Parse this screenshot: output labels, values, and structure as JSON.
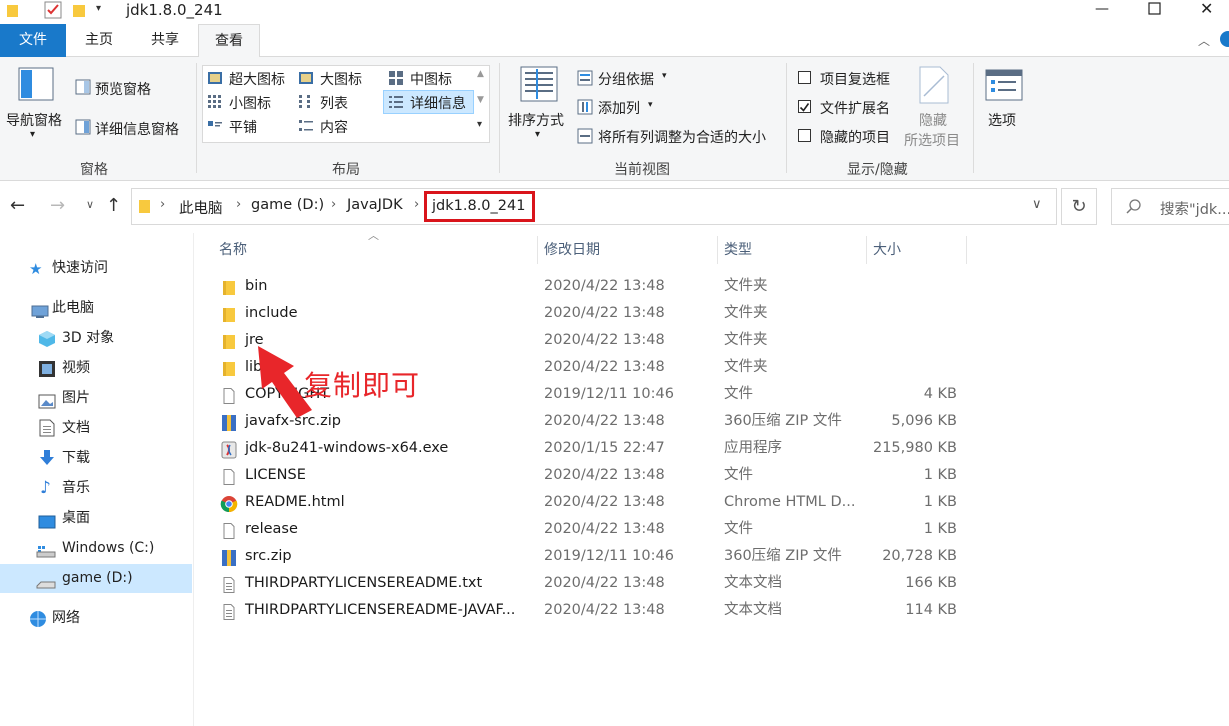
{
  "window": {
    "title": "jdk1.8.0_241"
  },
  "menu_tabs": [
    {
      "label": "文件"
    },
    {
      "label": "主页"
    },
    {
      "label": "共享"
    },
    {
      "label": "查看"
    }
  ],
  "ribbon": {
    "pane": {
      "nav_pane": "导航窗格",
      "preview_pane": "预览窗格",
      "details_pane": "详细信息窗格",
      "group_label": "窗格"
    },
    "layout": {
      "items": [
        "超大图标",
        "大图标",
        "中图标",
        "小图标",
        "列表",
        "详细信息",
        "平铺",
        "内容"
      ],
      "group_label": "布局"
    },
    "current_view": {
      "sort_by": "排序方式",
      "group_by": "分组依据",
      "add_columns": "添加列",
      "size_all_columns": "将所有列调整为合适的大小",
      "group_label": "当前视图"
    },
    "show_hide": {
      "item_checkboxes": "项目复选框",
      "file_extensions": "文件扩展名",
      "hidden_items": "隐藏的项目",
      "hide_selected": "隐藏",
      "hide_selected_2": "所选项目",
      "group_label": "显示/隐藏",
      "item_checkboxes_checked": false,
      "file_extensions_checked": true,
      "hidden_items_checked": false
    },
    "options": {
      "label": "选项"
    }
  },
  "address": {
    "crumbs": [
      "此电脑",
      "game (D:)",
      "JavaJDK",
      "jdk1.8.0_241"
    ],
    "search_placeholder": "搜索\"jdk..."
  },
  "sidebar": {
    "items": [
      {
        "label": "快速访问",
        "icon": "star-icon"
      },
      {
        "label": "此电脑",
        "icon": "computer-icon"
      },
      {
        "label": "3D 对象",
        "icon": "cube-icon"
      },
      {
        "label": "视频",
        "icon": "video-icon"
      },
      {
        "label": "图片",
        "icon": "picture-icon"
      },
      {
        "label": "文档",
        "icon": "document-icon"
      },
      {
        "label": "下载",
        "icon": "download-icon"
      },
      {
        "label": "音乐",
        "icon": "music-icon"
      },
      {
        "label": "桌面",
        "icon": "desktop-icon"
      },
      {
        "label": "Windows (C:)",
        "icon": "windows-drive-icon"
      },
      {
        "label": "game (D:)",
        "icon": "drive-icon",
        "selected": true
      },
      {
        "label": "网络",
        "icon": "network-icon"
      }
    ]
  },
  "columns": {
    "name": "名称",
    "modified": "修改日期",
    "type": "类型",
    "size": "大小"
  },
  "files": [
    {
      "name": "bin",
      "date": "2020/4/22 13:48",
      "type": "文件夹",
      "size": "",
      "icon": "folder-icon"
    },
    {
      "name": "include",
      "date": "2020/4/22 13:48",
      "type": "文件夹",
      "size": "",
      "icon": "folder-icon"
    },
    {
      "name": "jre",
      "date": "2020/4/22 13:48",
      "type": "文件夹",
      "size": "",
      "icon": "folder-icon"
    },
    {
      "name": "lib",
      "date": "2020/4/22 13:48",
      "type": "文件夹",
      "size": "",
      "icon": "folder-icon"
    },
    {
      "name": "COPYRIGHT",
      "date": "2019/12/11 10:46",
      "type": "文件",
      "size": "4 KB",
      "icon": "file-icon"
    },
    {
      "name": "javafx-src.zip",
      "date": "2020/4/22 13:48",
      "type": "360压缩 ZIP 文件",
      "size": "5,096 KB",
      "icon": "zip-icon"
    },
    {
      "name": "jdk-8u241-windows-x64.exe",
      "date": "2020/1/15 22:47",
      "type": "应用程序",
      "size": "215,980 KB",
      "icon": "exe-icon"
    },
    {
      "name": "LICENSE",
      "date": "2020/4/22 13:48",
      "type": "文件",
      "size": "1 KB",
      "icon": "file-icon"
    },
    {
      "name": "README.html",
      "date": "2020/4/22 13:48",
      "type": "Chrome HTML D...",
      "size": "1 KB",
      "icon": "chrome-icon"
    },
    {
      "name": "release",
      "date": "2020/4/22 13:48",
      "type": "文件",
      "size": "1 KB",
      "icon": "file-icon"
    },
    {
      "name": "src.zip",
      "date": "2019/12/11 10:46",
      "type": "360压缩 ZIP 文件",
      "size": "20,728 KB",
      "icon": "zip-icon"
    },
    {
      "name": "THIRDPARTYLICENSEREADME.txt",
      "date": "2020/4/22 13:48",
      "type": "文本文档",
      "size": "166 KB",
      "icon": "text-file-icon"
    },
    {
      "name": "THIRDPARTYLICENSEREADME-JAVAF...",
      "date": "2020/4/22 13:48",
      "type": "文本文档",
      "size": "114 KB",
      "icon": "text-file-icon"
    }
  ],
  "annotation": {
    "text": "复制即可",
    "color": "#e8262a"
  },
  "colors": {
    "accent": "#1979ca",
    "selected": "#cce8ff",
    "folder": "#f8c93e",
    "highlight_box": "#d9141b"
  }
}
